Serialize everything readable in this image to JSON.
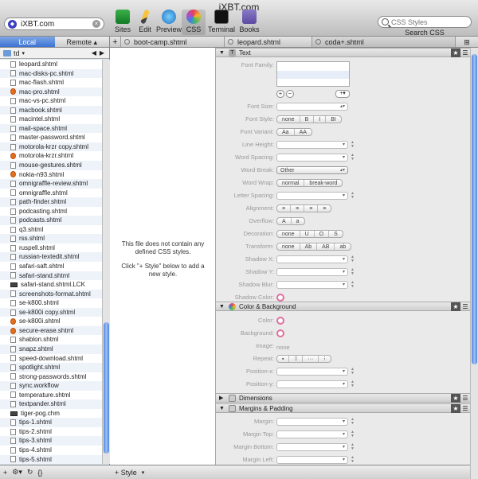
{
  "window": {
    "title": "iXBT.com"
  },
  "site": {
    "name": "iXBT.com"
  },
  "toolbar": {
    "buttons": [
      {
        "label": "Sites"
      },
      {
        "label": "Edit"
      },
      {
        "label": "Preview"
      },
      {
        "label": "CSS"
      },
      {
        "label": "Terminal"
      },
      {
        "label": "Books"
      }
    ],
    "search_placeholder": "CSS Styles",
    "search_label": "Search CSS"
  },
  "sidebar": {
    "tabs": [
      "Local",
      "Remote"
    ],
    "path": "td",
    "files": [
      "leopard.shtml",
      "mac-disks-pc.shtml",
      "mac-flash.shtml",
      "mac-pro.shtml",
      "mac-vs-pc.shtml",
      "macbook.shtml",
      "macintel.shtml",
      "mail-space.shtml",
      "master-password.shtml",
      "motorola-krzr copy.shtml",
      "motorola-krzr.shtml",
      "mouse-gestures.shtml",
      "nokia-n93.shtml",
      "omnigraffle-review.shtml",
      "omnigraffle.shtml",
      "path-finder.shtml",
      "podcasting.shtml",
      "podcasts.shtml",
      "q3.shtml",
      "rss.shtml",
      "ruspell.shtml",
      "russian-textedit.shtml",
      "safari-saft.shtml",
      "safari-stand.shtml",
      "safari-stand.shtml.LCK",
      "screenshots-format.shtml",
      "se-k800.shtml",
      "se-k800i copy.shtml",
      "se-k800i.shtml",
      "secure-erase.shtml",
      "shablon.shtml",
      "snapz.shtml",
      "speed-download.shtml",
      "spotlight.shtml",
      "strong-passwords.shtml",
      "sync.workflow",
      "temperature.shtml",
      "textpander.shtml",
      "tiger-pog.chm",
      "tips-1.shtml",
      "tips-2.shtml",
      "tips-3.shtml",
      "tips-4.shtml",
      "tips-5.shtml"
    ]
  },
  "tabs": [
    "boot-camp.shtml",
    "leopard.shtml",
    "coda+.shtml"
  ],
  "editor": {
    "empty_line1": "This file does not contain any defined CSS styles.",
    "empty_line2": "Click \"+ Style\" below to add a new style.",
    "add_style": "+ Style"
  },
  "css_panel": {
    "sections": {
      "text": "Text",
      "color": "Color & Background",
      "dimensions": "Dimensions",
      "margins": "Margins & Padding"
    },
    "labels": {
      "font_family": "Font Family:",
      "font_size": "Font Size:",
      "font_style": "Font Style:",
      "font_variant": "Font Variant:",
      "line_height": "Line Height:",
      "word_spacing": "Word Spacing:",
      "word_break": "Word Break:",
      "word_wrap": "Word Wrap:",
      "letter_spacing": "Letter Spacing:",
      "alignment": "Alignment:",
      "overflow": "Overflow:",
      "decoration": "Decoration:",
      "transform": "Transform:",
      "shadow_x": "Shadow X:",
      "shadow_y": "Shadow Y:",
      "shadow_blur": "Shadow Blur:",
      "shadow_color": "Shadow Color:",
      "color": "Color:",
      "background": "Background:",
      "image": "Image:",
      "repeat": "Repeat:",
      "position_x": "Position-x:",
      "position_y": "Position-y:",
      "margin": "Margin:",
      "margin_top": "Margin Top:",
      "margin_bottom": "Margin Bottom:",
      "margin_left": "Margin Left:"
    },
    "font_style_seg": [
      "none",
      "B",
      "I",
      "BI"
    ],
    "font_variant_seg": [
      "Aa",
      "AA"
    ],
    "word_break_value": "Other",
    "word_wrap_seg": [
      "normal",
      "break-word"
    ],
    "decoration_seg": [
      "none",
      "U",
      "O",
      "S"
    ],
    "transform_seg": [
      "none",
      "Ab",
      "AB",
      "ab"
    ],
    "image_value": "none",
    "add_popup": "+"
  }
}
